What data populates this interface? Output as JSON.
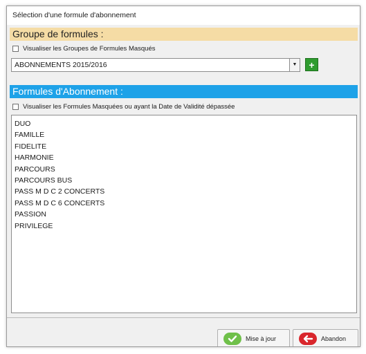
{
  "window": {
    "title": "Sélection d'une formule d'abonnement"
  },
  "groups": {
    "header": "Groupe de formules :",
    "checkbox_label": "Visualiser les Groupes de Formules Masqués",
    "selected_value": "ABONNEMENTS 2015/2016"
  },
  "formules": {
    "header": "Formules d'Abonnement :",
    "checkbox_label": "Visualiser les Formules Masquées ou ayant la Date de Validité dépassée",
    "items": [
      "DUO",
      "FAMILLE",
      "FIDELITE",
      "HARMONIE",
      "PARCOURS",
      "PARCOURS BUS",
      "PASS M D C 2 CONCERTS",
      "PASS M D C 6 CONCERTS",
      "PASSION",
      "PRIVILEGE"
    ]
  },
  "buttons": {
    "update_label": "Mise à jour",
    "cancel_label": "Abandon"
  },
  "colors": {
    "groups_header_bg": "#f5dca5",
    "formules_header_bg": "#1ea2e8",
    "update_icon": "#6fc04a",
    "cancel_icon": "#d9262c"
  }
}
